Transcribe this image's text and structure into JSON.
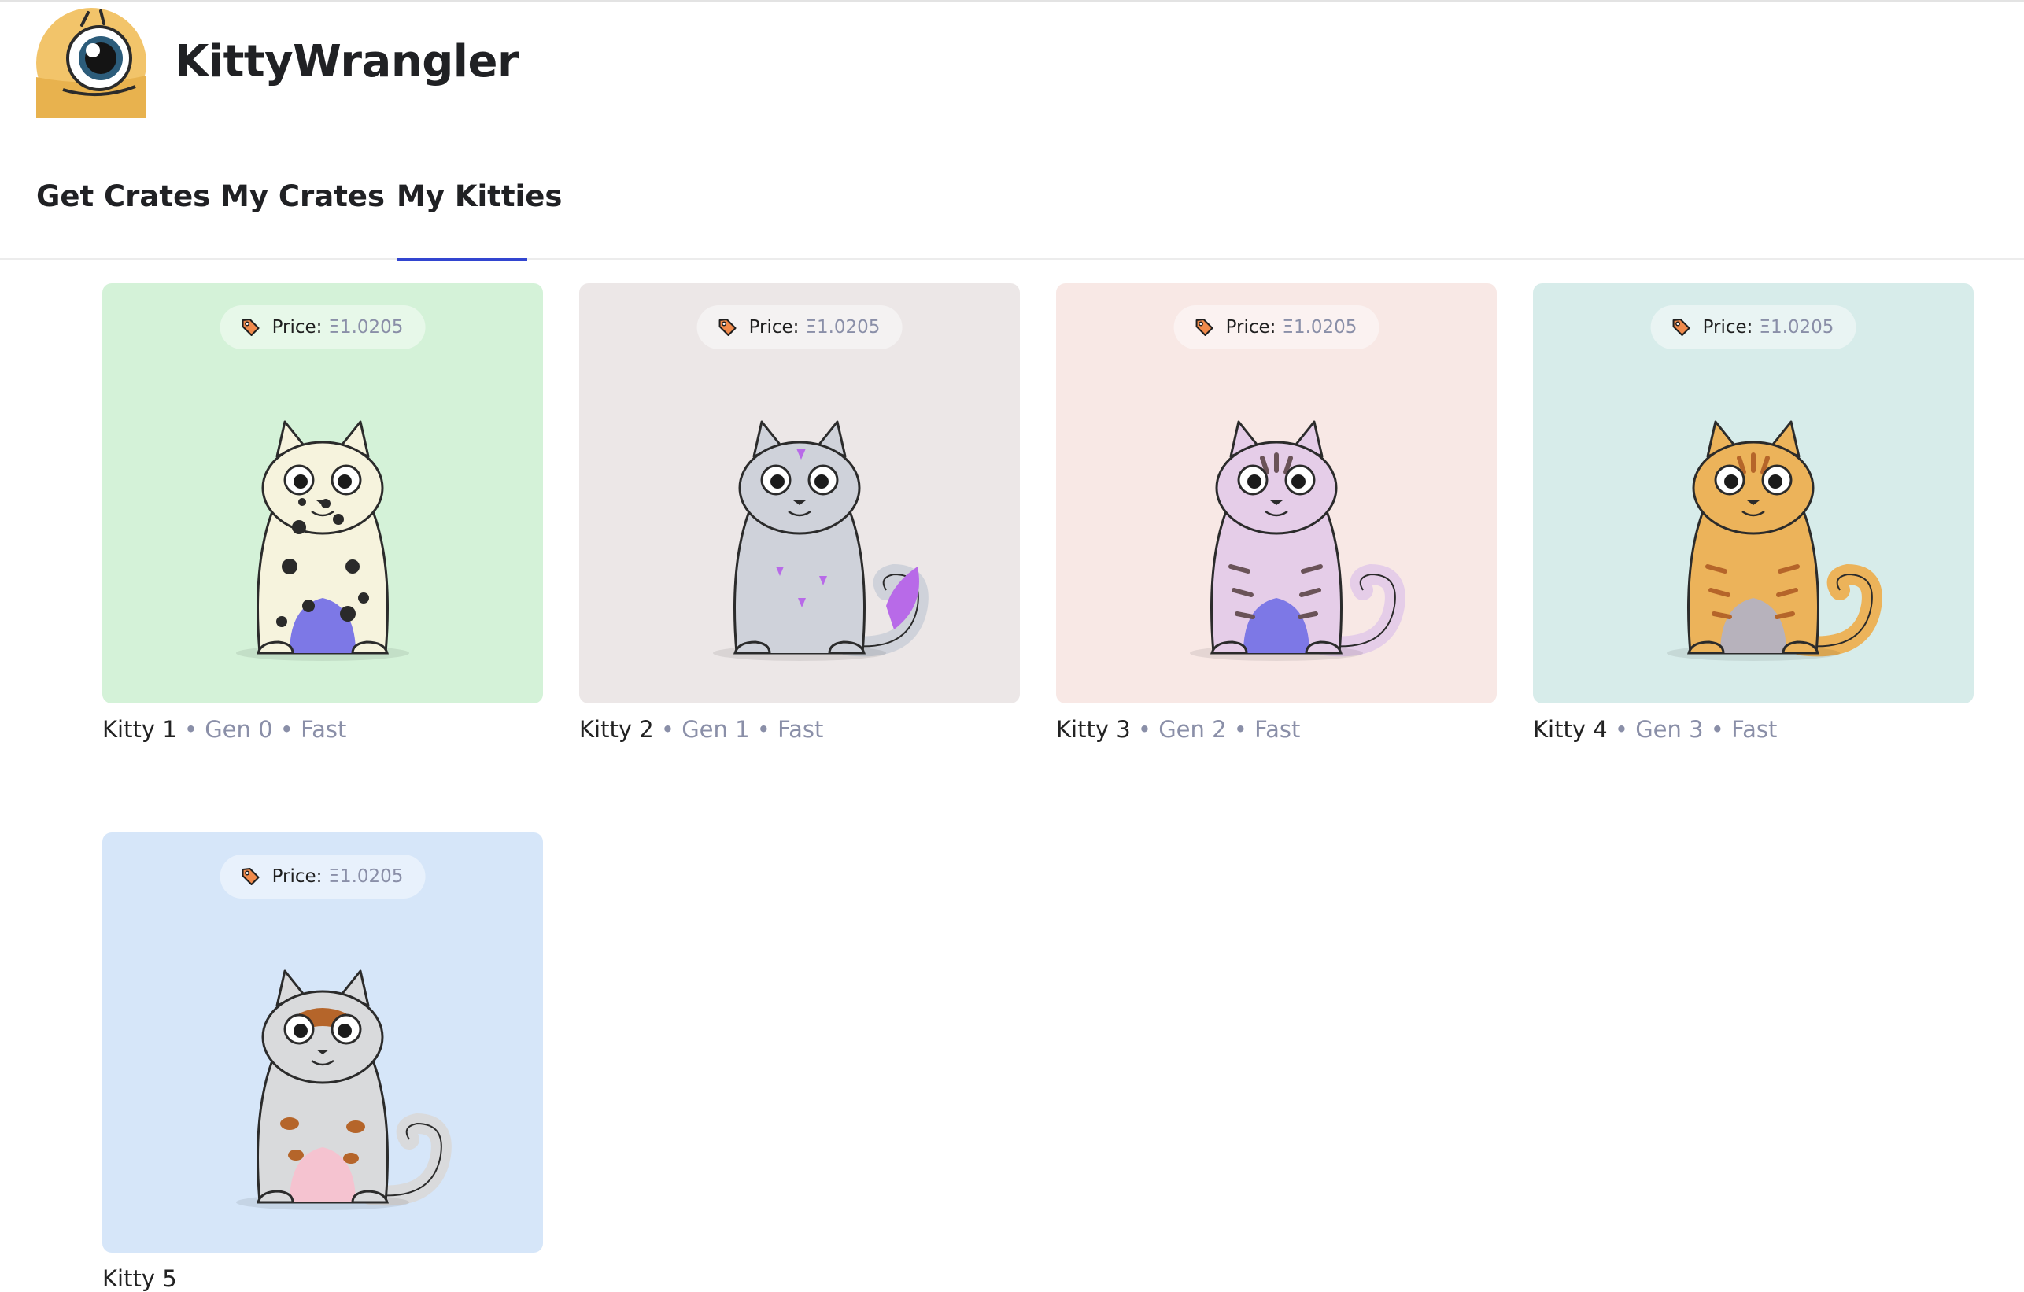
{
  "app": {
    "title": "KittyWrangler"
  },
  "nav": {
    "tabs": [
      {
        "label": "Get Crates"
      },
      {
        "label": "My Crates"
      },
      {
        "label": "My Kitties"
      }
    ],
    "active": "My Kitties"
  },
  "accent": "#3245d0",
  "kitties": [
    {
      "name": "Kitty 1",
      "meta": " • Gen 0 • Fast",
      "price_label": "Price:",
      "price": "Ξ1.0205",
      "bg": "#d4f2d8",
      "body": "#f6f3dd",
      "belly": "#7d78e6",
      "marking": "spots"
    },
    {
      "name": "Kitty 2",
      "meta": " • Gen 1 • Fast",
      "price_label": "Price:",
      "price": "Ξ1.0205",
      "bg": "#ece7e7",
      "body": "#cfd2da",
      "belly": "#cfd2da",
      "marking": "purple"
    },
    {
      "name": "Kitty 3",
      "meta": " • Gen 2 • Fast",
      "price_label": "Price:",
      "price": "Ξ1.0205",
      "bg": "#f8e8e5",
      "body": "#e5cde8",
      "belly": "#7d78e6",
      "marking": "stripes"
    },
    {
      "name": "Kitty 4",
      "meta": " • Gen 3 • Fast",
      "price_label": "Price:",
      "price": "Ξ1.0205",
      "bg": "#d7ecea",
      "body": "#ecb35a",
      "belly": "#b7b2bc",
      "marking": "tabby"
    },
    {
      "name": "Kitty 5",
      "meta": "",
      "price_label": "Price:",
      "price": "Ξ1.0205",
      "bg": "#d6e6f9",
      "body": "#d9dadc",
      "belly": "#f5c3d0",
      "marking": "brown"
    }
  ]
}
